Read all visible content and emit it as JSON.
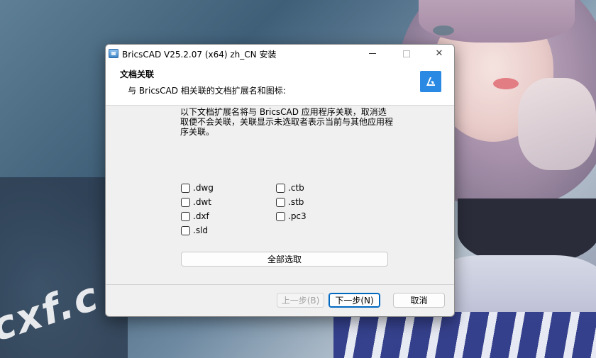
{
  "window": {
    "title": "BricsCAD V25.2.07 (x64) zh_CN 安装",
    "minimize_icon": "minimize-icon",
    "maximize_icon": "maximize-icon",
    "close_glyph": "✕"
  },
  "header": {
    "title": "文档关联",
    "subtitle": "与 BricsCAD 相关联的文档扩展名和图标:",
    "logo_icon": "bricscad-logo-icon",
    "logo_color": "#2a8ae3"
  },
  "description": "以下文档扩展名将与 BricsCAD 应用程序关联，取消选取便不会关联，关联显示未选取者表示当前与其他应用程序关联。",
  "extensions": {
    "left": [
      {
        "label": ".dwg",
        "checked": false
      },
      {
        "label": ".dwt",
        "checked": false
      },
      {
        "label": ".dxf",
        "checked": false
      },
      {
        "label": ".sld",
        "checked": false
      }
    ],
    "right": [
      {
        "label": ".ctb",
        "checked": false
      },
      {
        "label": ".stb",
        "checked": false
      },
      {
        "label": ".pc3",
        "checked": false
      }
    ]
  },
  "select_all_label": "全部选取",
  "buttons": {
    "back": "上一步(B)",
    "next": "下一步(N)",
    "cancel": "取消"
  },
  "wallpaper": {
    "watermark": "cxf.c"
  }
}
